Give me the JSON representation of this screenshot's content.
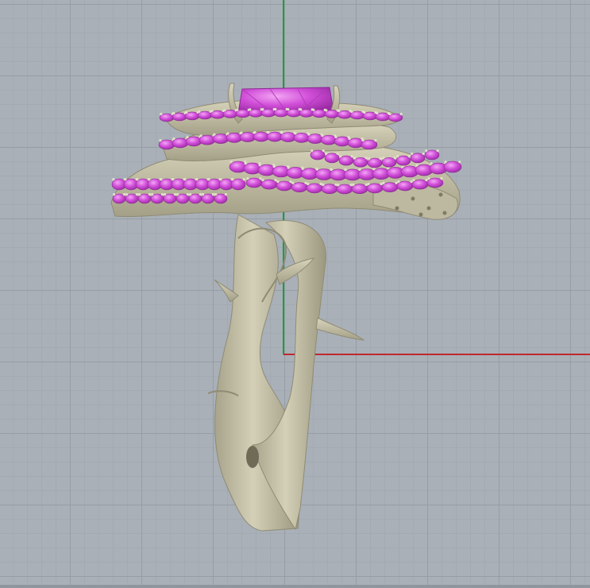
{
  "viewport": {
    "background_color": "#a9b0b8",
    "grid_color": "#969ca4",
    "x_axis_color": "#c0282d",
    "y_axis_color": "#1aa03a"
  },
  "model": {
    "metal_color": "#c9c5ad",
    "metal_shade_color": "#9b977f",
    "gem_color": "#d14fd9",
    "gem_highlight_color": "#ee99f0"
  }
}
